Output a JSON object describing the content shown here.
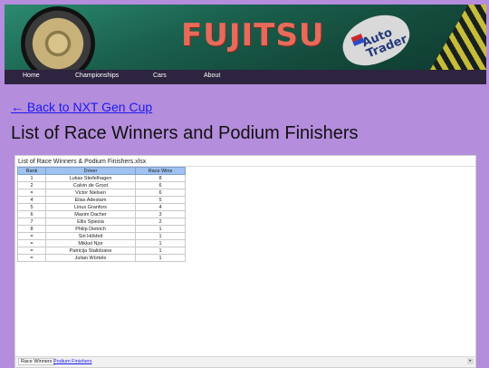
{
  "header": {
    "brand_text": "FUJITSU",
    "sticker_text": "Auto Trader"
  },
  "nav": {
    "items": [
      "Home",
      "Championships",
      "Cars",
      "About"
    ]
  },
  "back_link": "← Back to NXT Gen Cup",
  "page_title": "List of Race Winners and Podium Finishers",
  "sheet": {
    "file_name": "List of Race Winners & Podium Finishers.xlsx",
    "columns": [
      "Rank",
      "Driver",
      "Race Wins"
    ],
    "rows": [
      [
        "1",
        "Lukas Stiefelhagen",
        "8"
      ],
      [
        "2",
        "Calvin de Groot",
        "6"
      ],
      [
        "=",
        "Victor Nielsen",
        "6"
      ],
      [
        "4",
        "Elias Adestam",
        "5"
      ],
      [
        "5",
        "Linus Granfors",
        "4"
      ],
      [
        "6",
        "Maxim Dacher",
        "3"
      ],
      [
        "7",
        "Ellis Spiezia",
        "2"
      ],
      [
        "8",
        "Philip Dietrich",
        "1"
      ],
      [
        "=",
        "Siri Hökfelt",
        "1"
      ],
      [
        "=",
        "Mikkel Njor",
        "1"
      ],
      [
        "=",
        "Patricija Stalidzane",
        "1"
      ],
      [
        "=",
        "Julian Würtele",
        "1"
      ]
    ],
    "tabs": [
      "Race Winners",
      "Podium Finishers"
    ]
  }
}
